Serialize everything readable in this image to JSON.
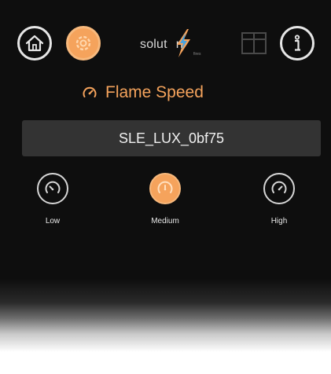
{
  "header": {
    "logo_text": "solut",
    "logo_text_tail": "n",
    "logo_subtext": "fires",
    "icons": {
      "home": "home-icon",
      "settings": "settings-icon",
      "logo_bolt": "lightning-bolt-icon",
      "box": "box-icon",
      "info": "info-icon"
    }
  },
  "section": {
    "title": "Flame Speed",
    "icon": "gauge-icon"
  },
  "device": {
    "name": "SLE_LUX_0bf75"
  },
  "speed_options": [
    {
      "label": "Low",
      "selected": false
    },
    {
      "label": "Medium",
      "selected": true
    },
    {
      "label": "High",
      "selected": false
    }
  ],
  "colors": {
    "accent": "#f5a35c",
    "background": "#0e0e0e",
    "field_background": "#333333",
    "text_light": "#f0f0f0"
  }
}
